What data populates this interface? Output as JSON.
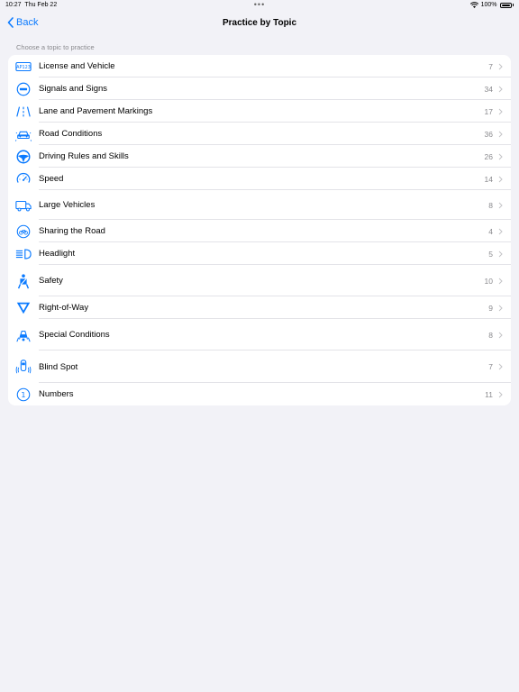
{
  "status": {
    "time": "10:27",
    "date": "Thu Feb 22",
    "battery": "100%"
  },
  "nav": {
    "back_label": "Back",
    "title": "Practice by Topic"
  },
  "section_header": "Choose a topic to practice",
  "accent_color": "#0a7aff",
  "topics": [
    {
      "label": "License and Vehicle",
      "count": "7",
      "icon": "license-plate-icon"
    },
    {
      "label": "Signals and Signs",
      "count": "34",
      "icon": "no-entry-sign-icon"
    },
    {
      "label": "Lane and Pavement Markings",
      "count": "17",
      "icon": "lane-markings-icon"
    },
    {
      "label": "Road Conditions",
      "count": "36",
      "icon": "car-road-conditions-icon"
    },
    {
      "label": "Driving Rules and Skills",
      "count": "26",
      "icon": "steering-wheel-icon"
    },
    {
      "label": "Speed",
      "count": "14",
      "icon": "speedometer-icon"
    },
    {
      "label": "Large Vehicles",
      "count": "8",
      "icon": "truck-icon"
    },
    {
      "label": "Sharing the Road",
      "count": "4",
      "icon": "bicycle-icon"
    },
    {
      "label": "Headlight",
      "count": "5",
      "icon": "headlight-icon"
    },
    {
      "label": "Safety",
      "count": "10",
      "icon": "seatbelt-icon"
    },
    {
      "label": "Right-of-Way",
      "count": "9",
      "icon": "yield-sign-icon"
    },
    {
      "label": "Special Conditions",
      "count": "8",
      "icon": "special-conditions-icon"
    },
    {
      "label": "Blind Spot",
      "count": "7",
      "icon": "blind-spot-icon"
    },
    {
      "label": "Numbers",
      "count": "11",
      "icon": "number-one-circle-icon"
    }
  ]
}
